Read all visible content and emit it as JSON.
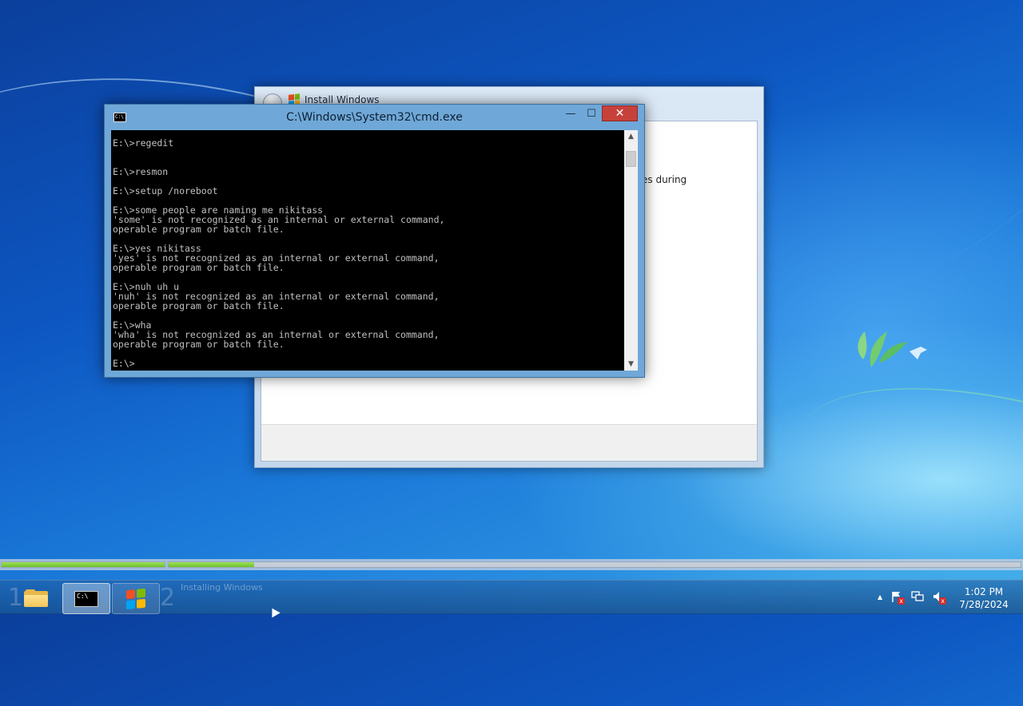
{
  "setup_window": {
    "title": "Install Windows",
    "partial_text": "es during"
  },
  "cmd_window": {
    "title": "C:\\Windows\\System32\\cmd.exe",
    "icon_text": "C:\\",
    "minimize_label": "—",
    "maximize_label": "☐",
    "close_label": "✕",
    "console_text": "E:\\>regedit\n\n\nE:\\>resmon\n\nE:\\>setup /noreboot\n\nE:\\>some people are naming me nikitass\n'some' is not recognized as an internal or external command,\noperable program or batch file.\n\nE:\\>yes nikitass\n'yes' is not recognized as an internal or external command,\noperable program or batch file.\n\nE:\\>nuh uh u\n'nuh' is not recognized as an internal or external command,\noperable program or batch file.\n\nE:\\>wha\n'wha' is not recognized as an internal or external command,\noperable program or batch file.\n\nE:\\>"
  },
  "setup_progress": {
    "step1_label": "1",
    "step2_label": "2",
    "step2_caption": "Installing Windows",
    "step1_fill": 1.0,
    "step2_fill": 0.1
  },
  "taskbar": {
    "buttons": [
      "explorer-folder-icon",
      "cmd-icon",
      "windows-setup-icon"
    ],
    "tray_icons": [
      "show-hidden-icons-arrow",
      "action-center-icon",
      "network-icon",
      "volume-muted-icon"
    ],
    "tray_arrow": "▲",
    "clock_time": "1:02 PM",
    "clock_date": "7/28/2024"
  },
  "colors": {
    "close_button": "#c7413b",
    "progress_green": "#7fd13b",
    "console_background": "#000000",
    "console_text": "#c0c0c0"
  }
}
